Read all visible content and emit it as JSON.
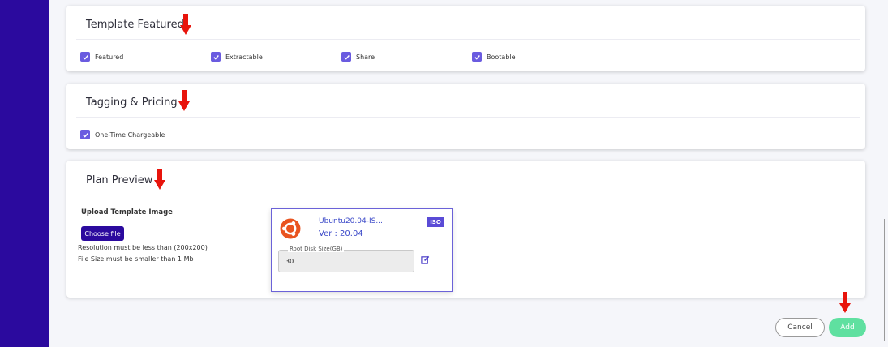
{
  "sections": {
    "featured": {
      "title": "Template Featured",
      "checkboxes": [
        {
          "label": "Featured",
          "checked": true
        },
        {
          "label": "Extractable",
          "checked": true
        },
        {
          "label": "Share",
          "checked": true
        },
        {
          "label": "Bootable",
          "checked": true
        }
      ]
    },
    "pricing": {
      "title": "Tagging & Pricing",
      "checkboxes": [
        {
          "label": "One-Time Chargeable",
          "checked": true
        }
      ]
    },
    "preview": {
      "title": "Plan Preview",
      "upload_label": "Upload Template Image",
      "choose_file": "Choose file",
      "resolution_note": "Resolution must be less than (200x200)",
      "size_note": "File Size must be smaller than 1 Mb",
      "card": {
        "os_name": "Ubuntu20.04-IS...",
        "version": "Ver : 20.04",
        "badge": "ISO",
        "disk_label": "Root Disk Size(GB)",
        "disk_value": "30",
        "logo_icon": "ubuntu-logo-icon",
        "edit_icon": "edit-icon"
      }
    }
  },
  "actions": {
    "cancel": "Cancel",
    "add": "Add"
  },
  "colors": {
    "sidebar": "#2b0a9e",
    "accent": "#6a5be0",
    "add_button": "#5fe0a0",
    "ubuntu": "#e95420",
    "arrow": "#e8140c"
  }
}
